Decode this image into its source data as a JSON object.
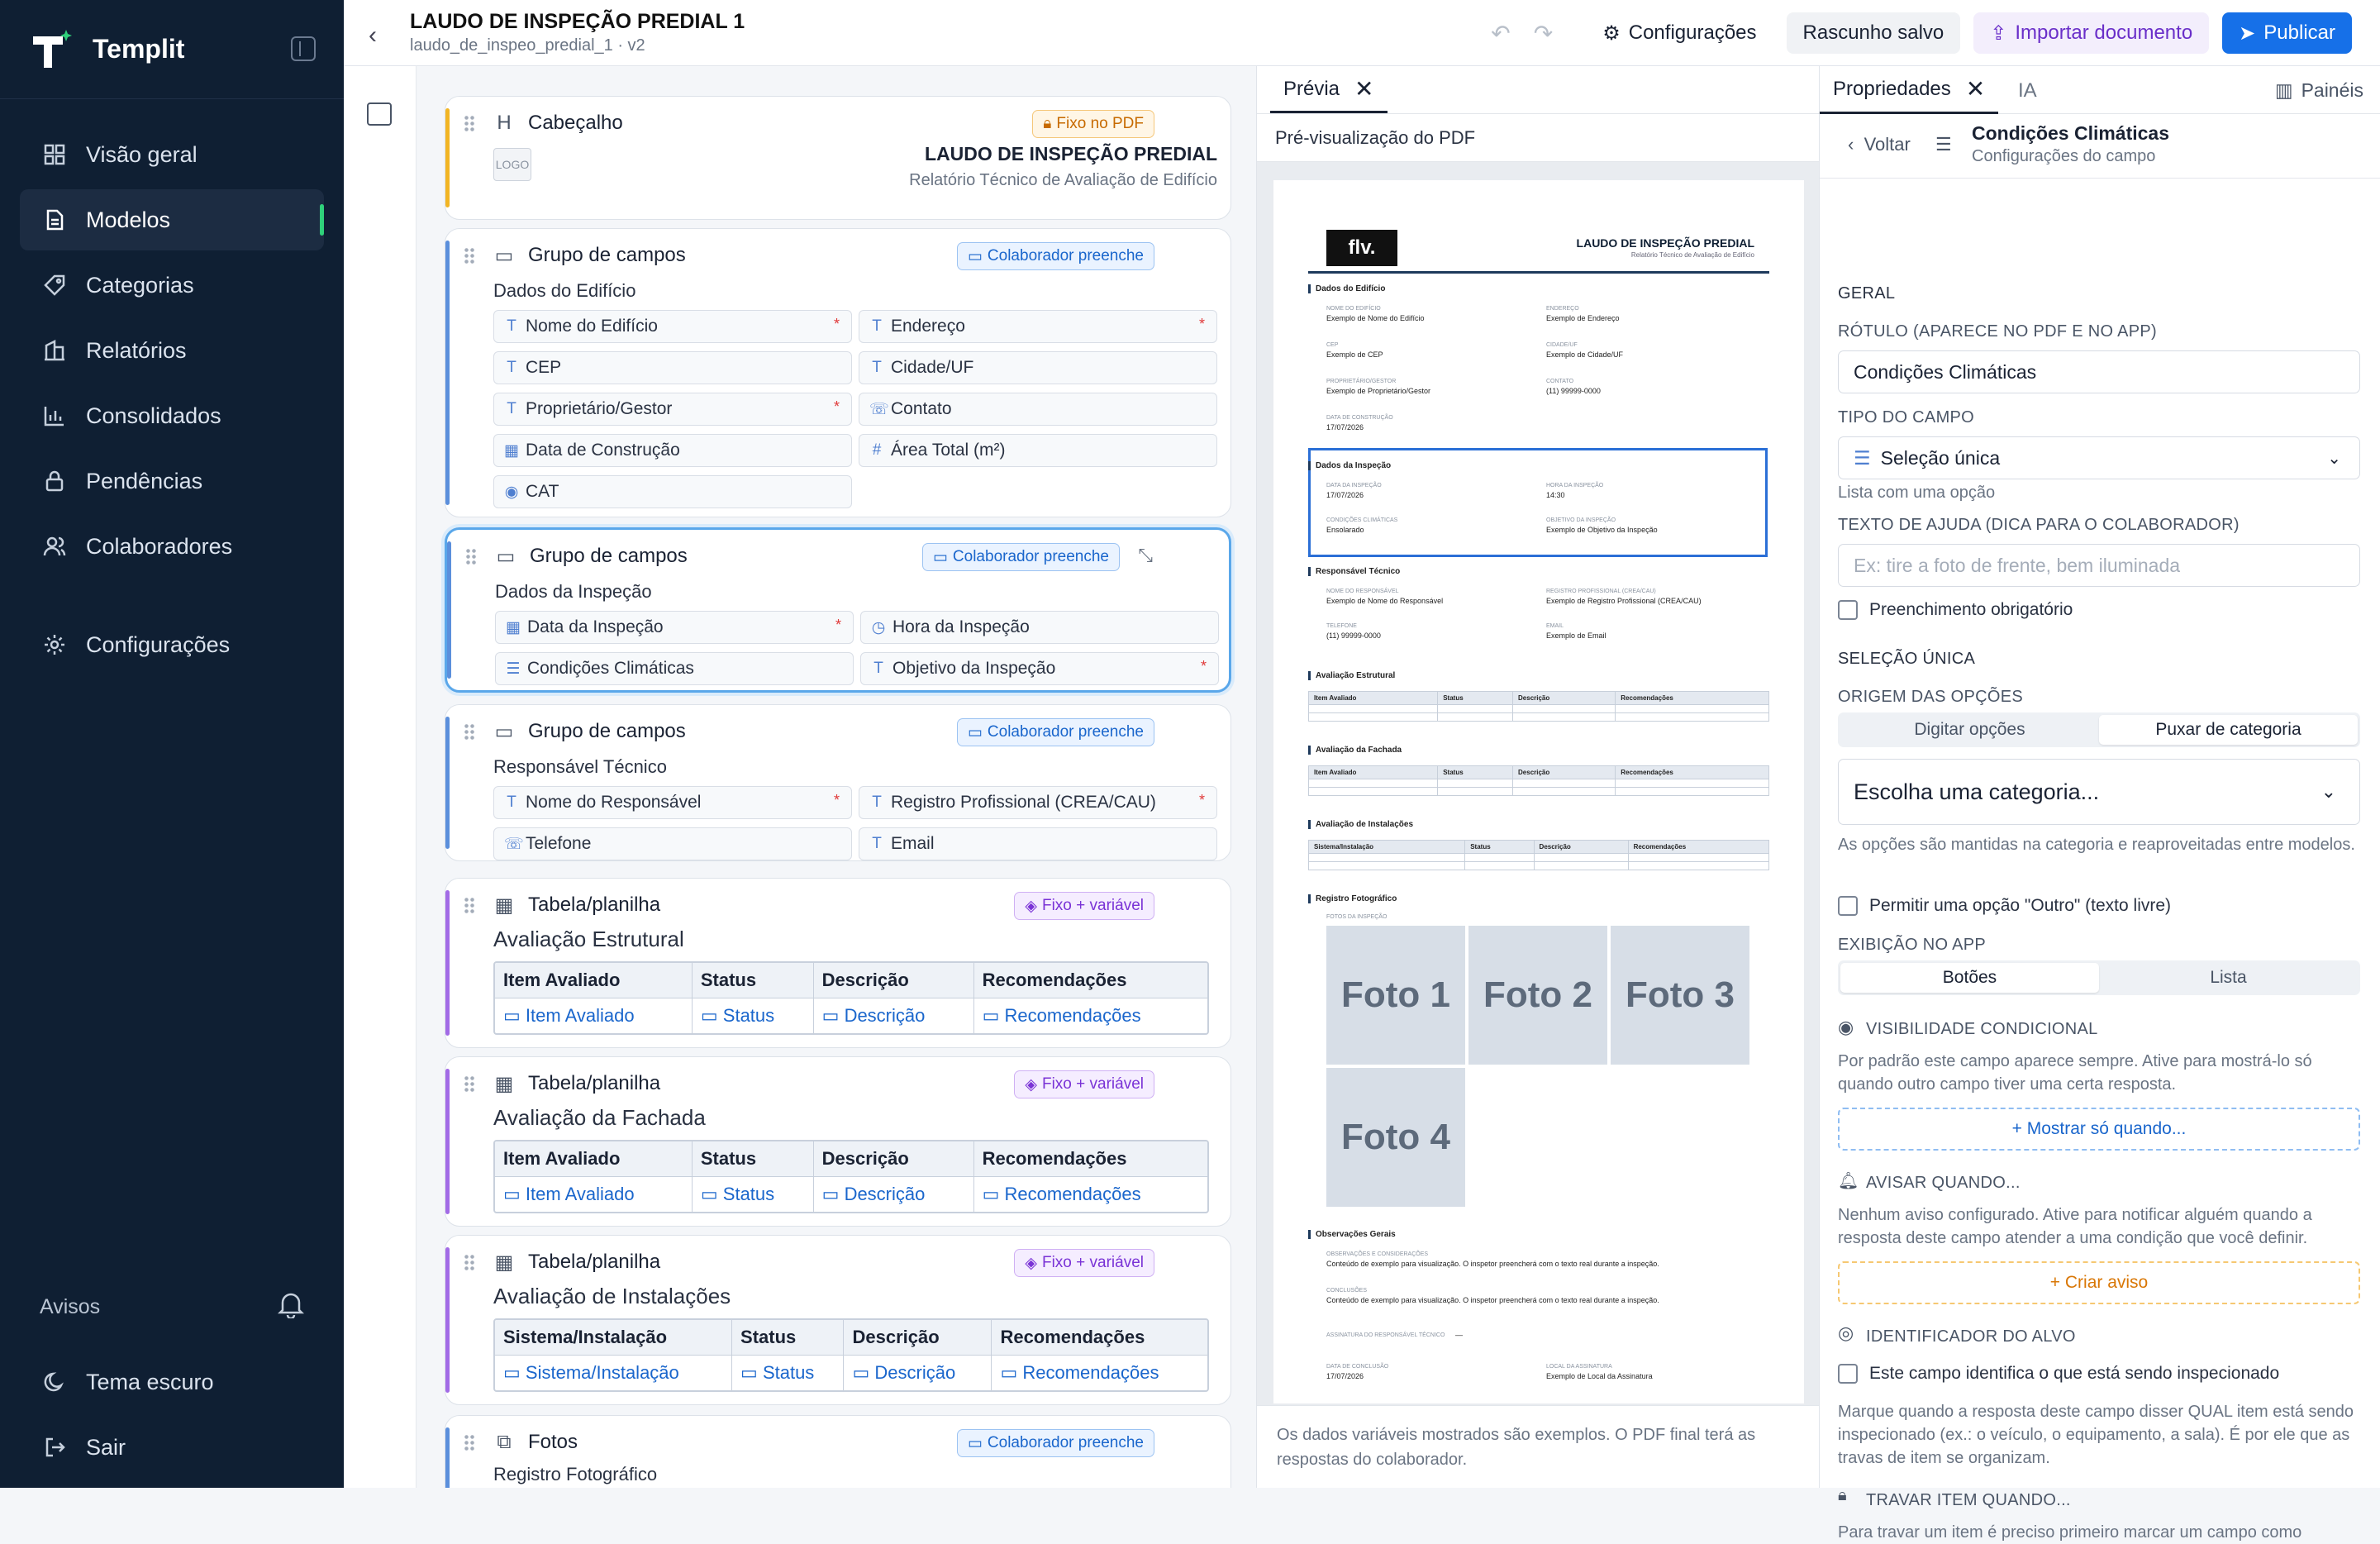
{
  "app": {
    "name": "Templit"
  },
  "sidebar": {
    "items": [
      {
        "label": "Visão geral",
        "icon": "grid-icon"
      },
      {
        "label": "Modelos",
        "icon": "document-icon",
        "active": true
      },
      {
        "label": "Categorias",
        "icon": "tag-icon"
      },
      {
        "label": "Relatórios",
        "icon": "building-icon"
      },
      {
        "label": "Consolidados",
        "icon": "bar-chart-icon"
      },
      {
        "label": "Pendências",
        "icon": "lock-icon"
      },
      {
        "label": "Colaboradores",
        "icon": "users-icon"
      },
      {
        "label": "Configurações",
        "icon": "gear-icon"
      }
    ],
    "notices_label": "Avisos",
    "dark_theme_label": "Tema escuro",
    "logout_label": "Sair"
  },
  "topbar": {
    "title": "LAUDO DE INSPEÇÃO PREDIAL 1",
    "subtitle": "laudo_de_inspeo_predial_1 · v2",
    "settings_label": "Configurações",
    "draft_label": "Rascunho salvo",
    "import_label": "Importar documento",
    "publish_label": "Publicar"
  },
  "editor": {
    "header_card": {
      "type": "Cabeçalho",
      "badge": "Fixo no PDF",
      "logo": "LOGO",
      "title": "LAUDO DE INSPEÇÃO PREDIAL",
      "subtitle": "Relatório Técnico de Avaliação de Edifício"
    },
    "group_type": "Grupo de campos",
    "table_type": "Tabela/planilha",
    "photos_type": "Fotos",
    "badge_collab": "Colaborador preenche",
    "badge_fixed_var": "Fixo + variável",
    "groups": [
      {
        "name": "Dados do Edifício",
        "fields": [
          {
            "label": "Nome do Edifício",
            "icon": "T",
            "req": true
          },
          {
            "label": "Endereço",
            "icon": "T",
            "req": true
          },
          {
            "label": "CEP",
            "icon": "T",
            "req": false
          },
          {
            "label": "Cidade/UF",
            "icon": "T",
            "req": false
          },
          {
            "label": "Proprietário/Gestor",
            "icon": "T",
            "req": true
          },
          {
            "label": "Contato",
            "icon": "☏",
            "req": false
          },
          {
            "label": "Data de Construção",
            "icon": "▦",
            "req": false
          },
          {
            "label": "Área Total (m²)",
            "icon": "#",
            "req": false
          },
          {
            "label": "CAT",
            "icon": "◉",
            "req": false
          }
        ]
      },
      {
        "name": "Dados da Inspeção",
        "fields": [
          {
            "label": "Data da Inspeção",
            "icon": "▦",
            "req": true
          },
          {
            "label": "Hora da Inspeção",
            "icon": "◷",
            "req": false
          },
          {
            "label": "Condições Climáticas",
            "icon": "☰",
            "req": false
          },
          {
            "label": "Objetivo da Inspeção",
            "icon": "T",
            "req": true
          }
        ]
      },
      {
        "name": "Responsável Técnico",
        "fields": [
          {
            "label": "Nome do Responsável",
            "icon": "T",
            "req": true
          },
          {
            "label": "Registro Profissional (CREA/CAU)",
            "icon": "T",
            "req": true
          },
          {
            "label": "Telefone",
            "icon": "☏",
            "req": false
          },
          {
            "label": "Email",
            "icon": "T",
            "req": false
          }
        ]
      }
    ],
    "tables": [
      {
        "name": "Avaliação Estrutural",
        "headers": [
          "Item Avaliado",
          "Status",
          "Descrição",
          "Recomendações"
        ],
        "cells": [
          "Item Avaliado",
          "Status",
          "Descrição",
          "Recomendações"
        ]
      },
      {
        "name": "Avaliação da Fachada",
        "headers": [
          "Item Avaliado",
          "Status",
          "Descrição",
          "Recomendações"
        ],
        "cells": [
          "Item Avaliado",
          "Status",
          "Descrição",
          "Recomendações"
        ]
      },
      {
        "name": "Avaliação de Instalações",
        "headers": [
          "Sistema/Instalação",
          "Status",
          "Descrição",
          "Recomendações"
        ],
        "cells": [
          "Sistema/Instalação",
          "Status",
          "Descrição",
          "Recomendações"
        ]
      }
    ],
    "photos_card": {
      "name": "Registro Fotográfico"
    }
  },
  "preview": {
    "tab_label": "Prévia",
    "heading": "Pré-visualização do PDF",
    "footer": "Os dados variáveis mostrados são exemplos. O PDF final terá as respostas do colaborador.",
    "pdf": {
      "logo": "flv.",
      "title": "LAUDO DE INSPEÇÃO PREDIAL",
      "subtitle": "Relatório Técnico de Avaliação de Edifício",
      "s1": "Dados do Edifício",
      "s1_fields": [
        [
          "Nome do edifício",
          "Exemplo de Nome do Edifício"
        ],
        [
          "Endereço",
          "Exemplo de Endereço"
        ],
        [
          "CEP",
          "Exemplo de CEP"
        ],
        [
          "Cidade/UF",
          "Exemplo de Cidade/UF"
        ],
        [
          "Proprietário/Gestor",
          "Exemplo de Proprietário/Gestor"
        ],
        [
          "Contato",
          "(11) 99999-0000"
        ],
        [
          "Data de construção",
          "17/07/2026"
        ]
      ],
      "s2": "Dados da Inspeção",
      "s2_fields": [
        [
          "Data da inspeção",
          "17/07/2026"
        ],
        [
          "Hora da inspeção",
          "14:30"
        ],
        [
          "Condições climáticas",
          "Ensolarado"
        ],
        [
          "Objetivo da inspeção",
          "Exemplo de Objetivo da Inspeção"
        ]
      ],
      "s3": "Responsável Técnico",
      "s3_fields": [
        [
          "Nome do responsável",
          "Exemplo de Nome do Responsável"
        ],
        [
          "Registro profissional (CREA/CAU)",
          "Exemplo de Registro Profissional (CREA/CAU)"
        ],
        [
          "Telefone",
          "(11) 99999-0000"
        ],
        [
          "Email",
          "Exemplo de Email"
        ]
      ],
      "s4": "Avaliação Estrutural",
      "s5": "Avaliação da Fachada",
      "s6": "Avaliação de Instalações",
      "t_headers": [
        "Item Avaliado",
        "Status",
        "Descrição",
        "Recomendações"
      ],
      "t3_headers": [
        "Sistema/Instalação",
        "Status",
        "Descrição",
        "Recomendações"
      ],
      "s7": "Registro Fotográfico",
      "photos_label": "Fotos da inspeção",
      "photos": [
        "Foto 1",
        "Foto 2",
        "Foto 3",
        "Foto 4"
      ],
      "s8": "Observações Gerais",
      "obs_label": "Observações e considerações",
      "obs_text": "Conteúdo de exemplo para visualização. O inspetor preencherá com o texto real durante a inspeção.",
      "concl_label": "Conclusões",
      "concl_text": "Conteúdo de exemplo para visualização. O inspetor preencherá com o texto real durante a inspeção.",
      "sig_label": "Assinatura do responsável técnico",
      "sig_val": "—",
      "date_label": "Data de conclusão",
      "date_val": "17/07/2026",
      "place_label": "Local da assinatura",
      "place_val": "Exemplo de Local da Assinatura"
    }
  },
  "properties": {
    "tab_label": "Propriedades",
    "tab2_label": "IA",
    "panels_label": "Painéis",
    "back_label": "Voltar",
    "title": "Condições Climáticas",
    "subtitle": "Configurações do campo",
    "general": "GERAL",
    "label_h": "RÓTULO (APARECE NO PDF E NO APP)",
    "label_val": "Condições Climáticas",
    "type_h": "TIPO DO CAMPO",
    "type_val": "Seleção única",
    "type_hint": "Lista com uma opção",
    "help_h": "TEXTO DE AJUDA (DICA PARA O COLABORADOR)",
    "help_ph": "Ex: tire a foto de frente, bem iluminada",
    "required_label": "Preenchimento obrigatório",
    "single_h": "SELEÇÃO ÚNICA",
    "origin_h": "ORIGEM DAS OPÇÕES",
    "origin_opts": [
      "Digitar opções",
      "Puxar de categoria"
    ],
    "category_ph": "Escolha uma categoria...",
    "category_hint": "As opções são mantidas na categoria e reaproveitadas entre modelos.",
    "other_label": "Permitir uma opção \"Outro\" (texto livre)",
    "display_h": "EXIBIÇÃO NO APP",
    "display_opts": [
      "Botões",
      "Lista"
    ],
    "vis_h": "VISIBILIDADE CONDICIONAL",
    "vis_hint": "Por padrão este campo aparece sempre. Ative para mostrá-lo só quando outro campo tiver uma certa resposta.",
    "vis_btn": "+ Mostrar só quando...",
    "warn_h": "AVISAR QUANDO...",
    "warn_hint": "Nenhum aviso configurado. Ative para notificar alguém quando a resposta deste campo atender a uma condição que você definir.",
    "warn_btn": "+ Criar aviso",
    "target_h": "IDENTIFICADOR DO ALVO",
    "target_chk": "Este campo identifica o que está sendo inspecionado",
    "target_hint": "Marque quando a resposta deste campo disser QUAL item está sendo inspecionado (ex.: o veículo, o equipamento, a sala). É por ele que as travas de item se organizam.",
    "lock_h": "TRAVAR ITEM QUANDO...",
    "lock_hint": "Para travar um item é preciso primeiro marcar um campo como"
  }
}
